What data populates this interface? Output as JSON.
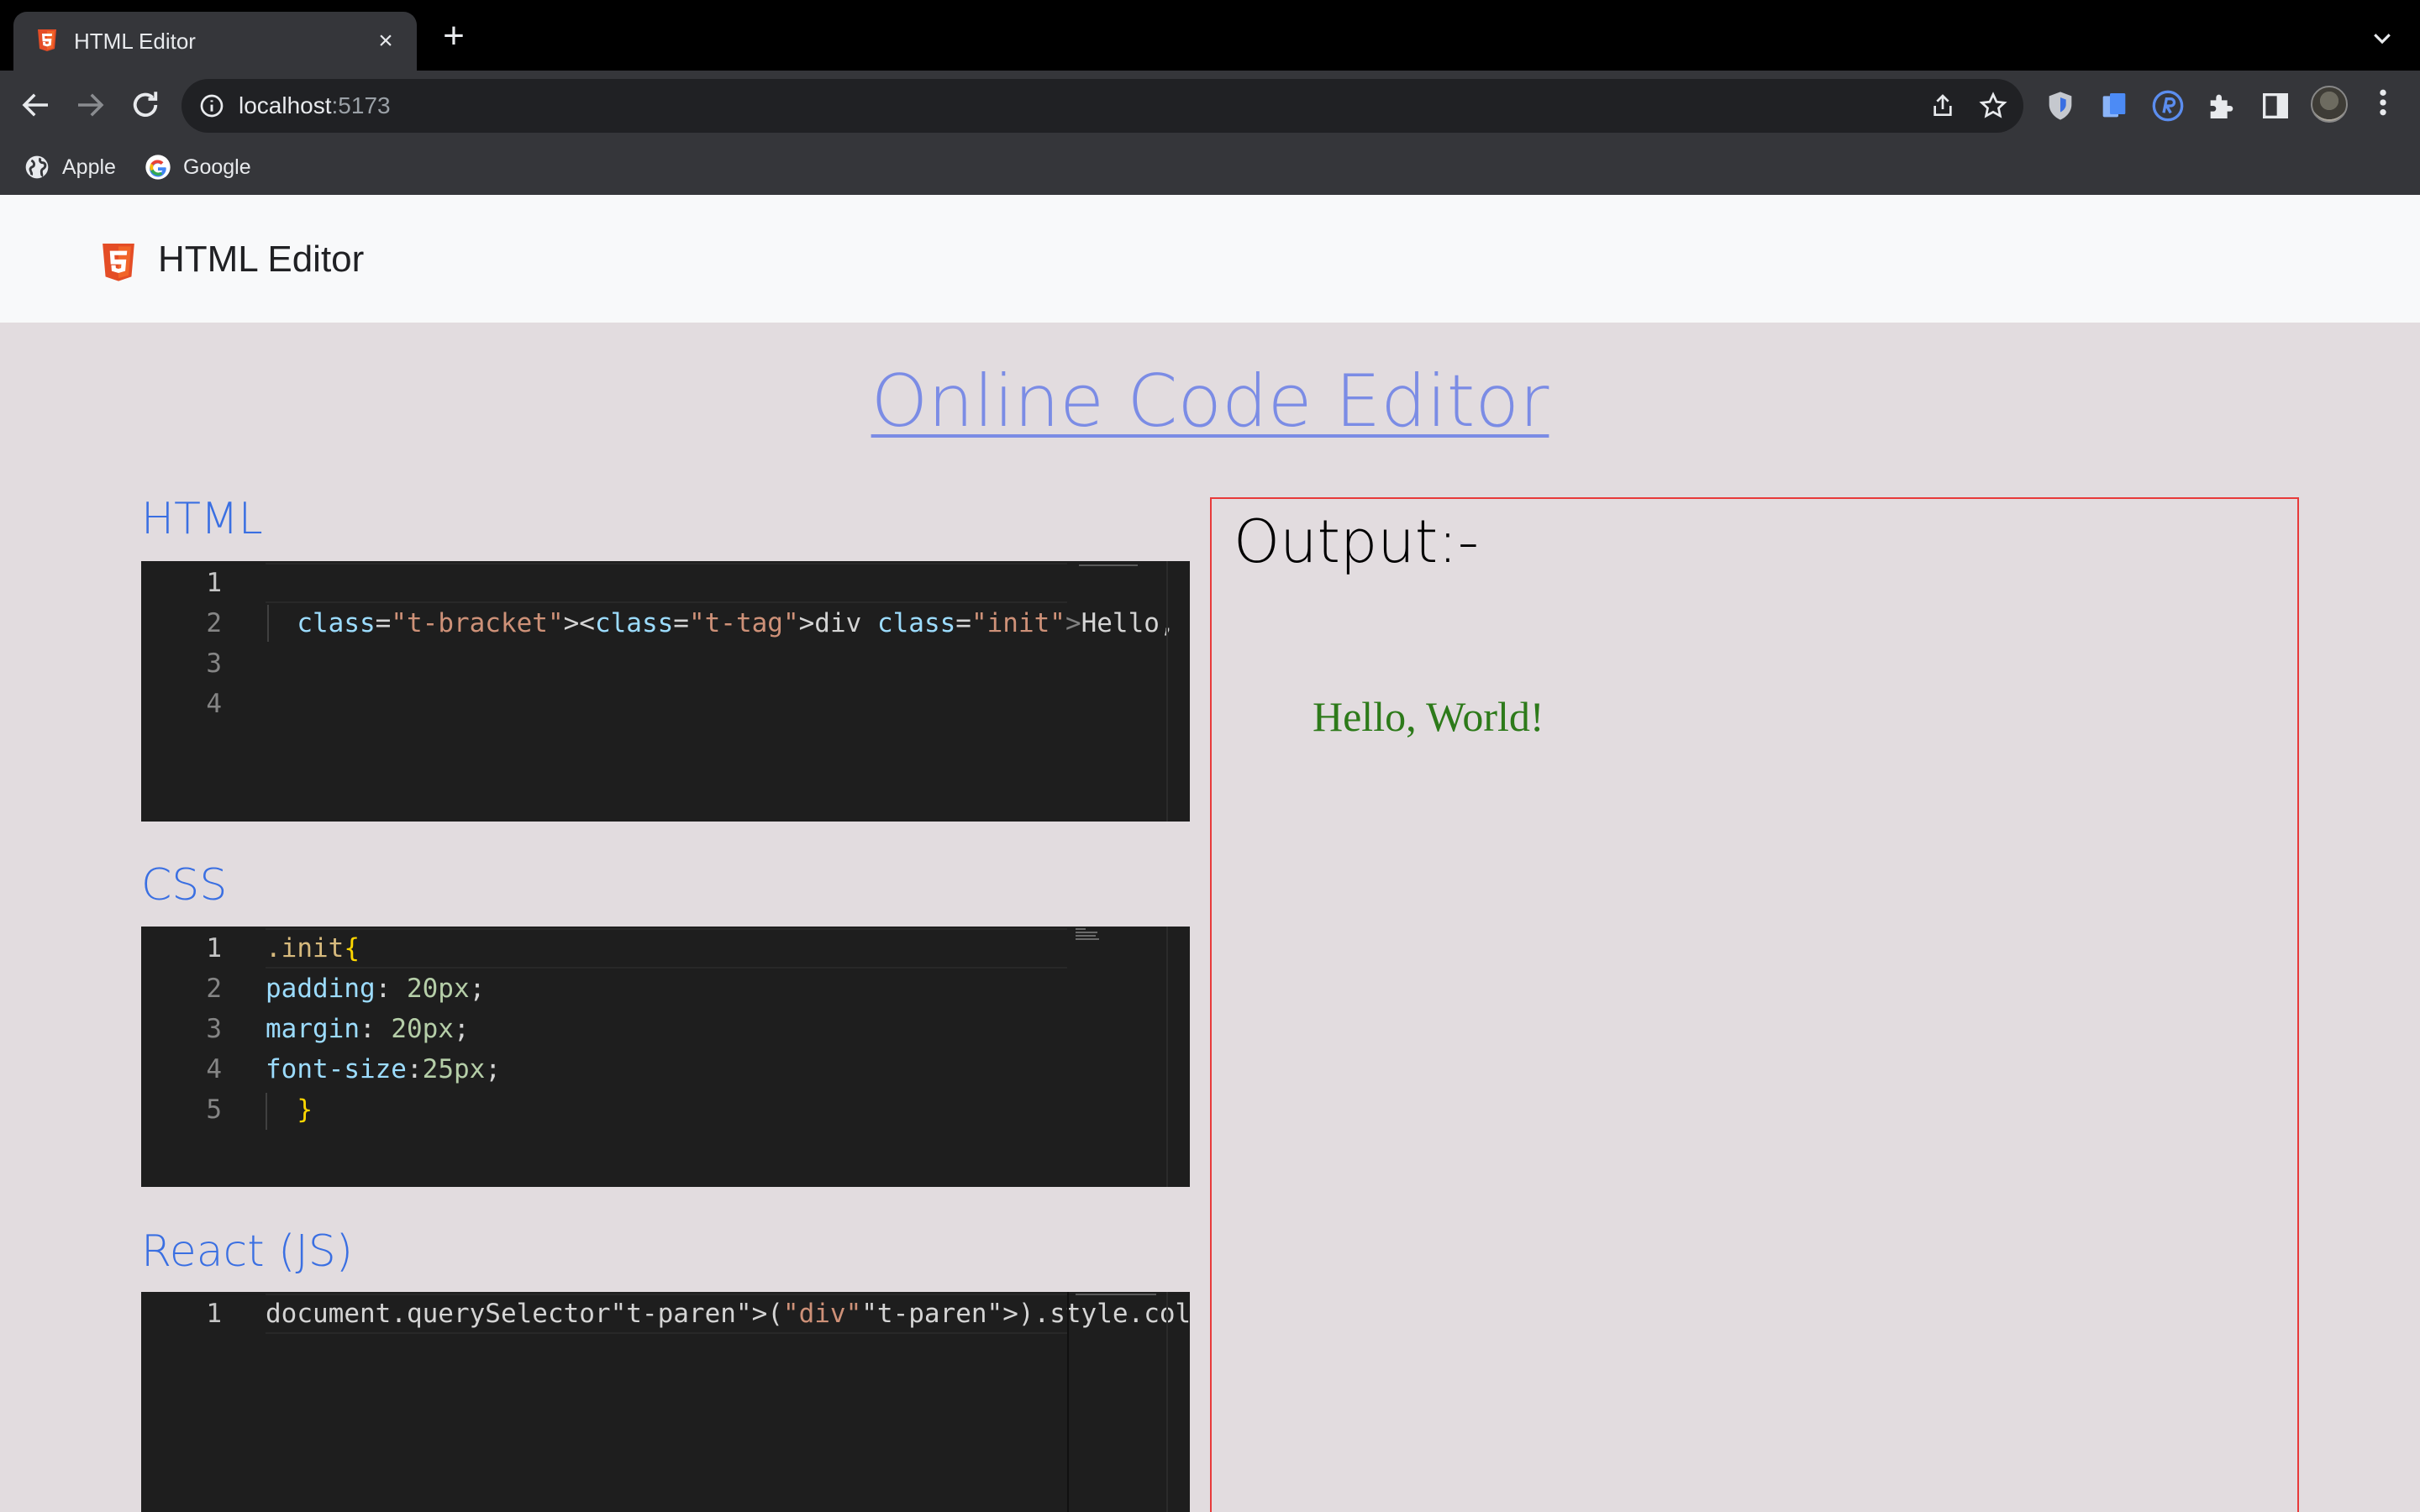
{
  "browser": {
    "tab_title": "HTML Editor",
    "tab_close": "×",
    "new_tab": "+",
    "url_host": "localhost",
    "url_port": ":5173",
    "bookmarks": [
      {
        "label": "Apple",
        "icon": "globe-icon"
      },
      {
        "label": "Google",
        "icon": "google-icon"
      }
    ]
  },
  "app": {
    "title": "HTML Editor",
    "heading": "Online Code Editor"
  },
  "editors": {
    "html": {
      "label": "HTML",
      "lines": [
        {
          "num": "1",
          "code": ""
        },
        {
          "num": "2",
          "code": "  <div class=\"init\">Hello, World!</div>"
        },
        {
          "num": "3",
          "code": ""
        },
        {
          "num": "4",
          "code": ""
        }
      ]
    },
    "css": {
      "label": "CSS",
      "lines": [
        {
          "num": "1",
          "code": ".init{"
        },
        {
          "num": "2",
          "code": "padding: 20px;"
        },
        {
          "num": "3",
          "code": "margin: 20px;"
        },
        {
          "num": "4",
          "code": "font-size:25px;"
        },
        {
          "num": "5",
          "code": "  }"
        }
      ]
    },
    "js": {
      "label": "React (JS)",
      "lines": [
        {
          "num": "1",
          "code": "document.querySelector(\"div\").style.color = \"green"
        }
      ]
    }
  },
  "output": {
    "title": "Output:-",
    "rendered_text": "Hello, World!",
    "rendered_color": "#2d7a1a"
  },
  "colors": {
    "page_bg": "#e2dcdf",
    "heading": "#7b8ce5",
    "section_label": "#3a6fe2",
    "output_border": "#e83a3a",
    "editor_bg": "#1e1e1e"
  }
}
